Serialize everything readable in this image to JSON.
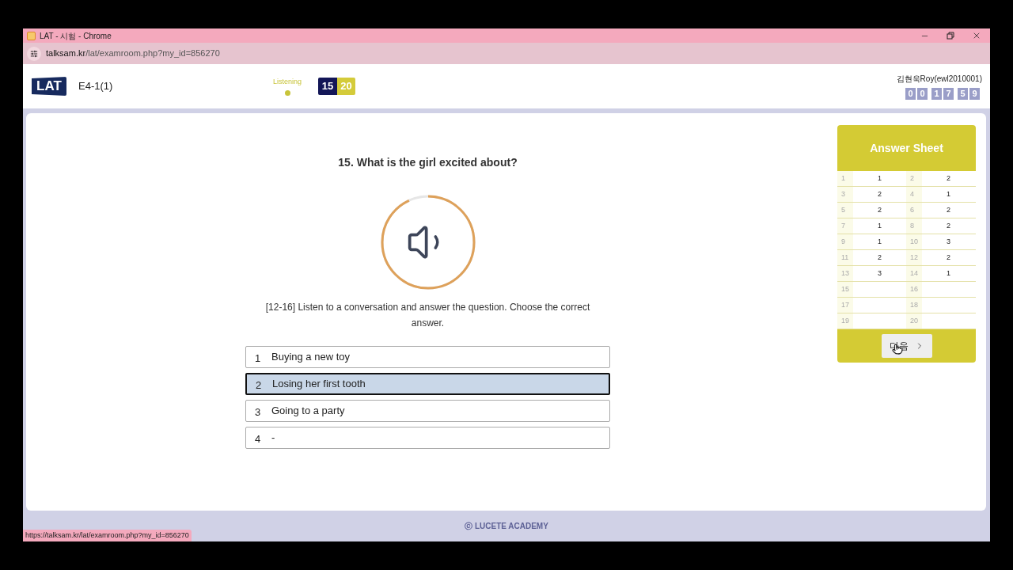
{
  "browser": {
    "title": "LAT - 시험 - Chrome",
    "url_host": "talksam.kr",
    "url_path": "/lat/examroom.php?my_id=856270"
  },
  "header": {
    "logo": "LAT",
    "exam_code": "E4-1(1)",
    "section": "Listening",
    "counter": {
      "current": "15",
      "total": "20"
    },
    "user": "김현욱Roy(ewl2010001)",
    "timer": [
      "0",
      "0",
      "1",
      "7",
      "5",
      "9"
    ]
  },
  "question": {
    "title": "15. What is the girl excited about?",
    "audio": {
      "level": 0.93
    },
    "instruction": "[12-16] Listen to a conversation and answer the question. Choose the correct answer.",
    "options": [
      {
        "number": "1",
        "text": "Buying a new toy",
        "selected": false
      },
      {
        "number": "2",
        "text": "Losing her first tooth",
        "selected": true
      },
      {
        "number": "3",
        "text": "Going to a party",
        "selected": false
      },
      {
        "number": "4",
        "text": "-",
        "selected": false
      }
    ]
  },
  "answer_sheet": {
    "title": "Answer Sheet",
    "rows": [
      [
        {
          "number": "1",
          "answer": "1"
        },
        {
          "number": "2",
          "answer": "2"
        }
      ],
      [
        {
          "number": "3",
          "answer": "2"
        },
        {
          "number": "4",
          "answer": "1"
        }
      ],
      [
        {
          "number": "5",
          "answer": "2"
        },
        {
          "number": "6",
          "answer": "2"
        }
      ],
      [
        {
          "number": "7",
          "answer": "1"
        },
        {
          "number": "8",
          "answer": "2"
        }
      ],
      [
        {
          "number": "9",
          "answer": "1"
        },
        {
          "number": "10",
          "answer": "3"
        }
      ],
      [
        {
          "number": "11",
          "answer": "2"
        },
        {
          "number": "12",
          "answer": "2"
        }
      ],
      [
        {
          "number": "13",
          "answer": "3"
        },
        {
          "number": "14",
          "answer": "1"
        }
      ],
      [
        {
          "number": "15"
        },
        {
          "number": "16"
        }
      ],
      [
        {
          "number": "17"
        },
        {
          "number": "18"
        }
      ],
      [
        {
          "number": "19"
        },
        {
          "number": "20"
        }
      ]
    ],
    "next_button": "다음"
  },
  "footer": "ⓒ LUCETE ACADEMY",
  "status_url": "https://talksam.kr/lat/examroom.php?my_id=856270"
}
